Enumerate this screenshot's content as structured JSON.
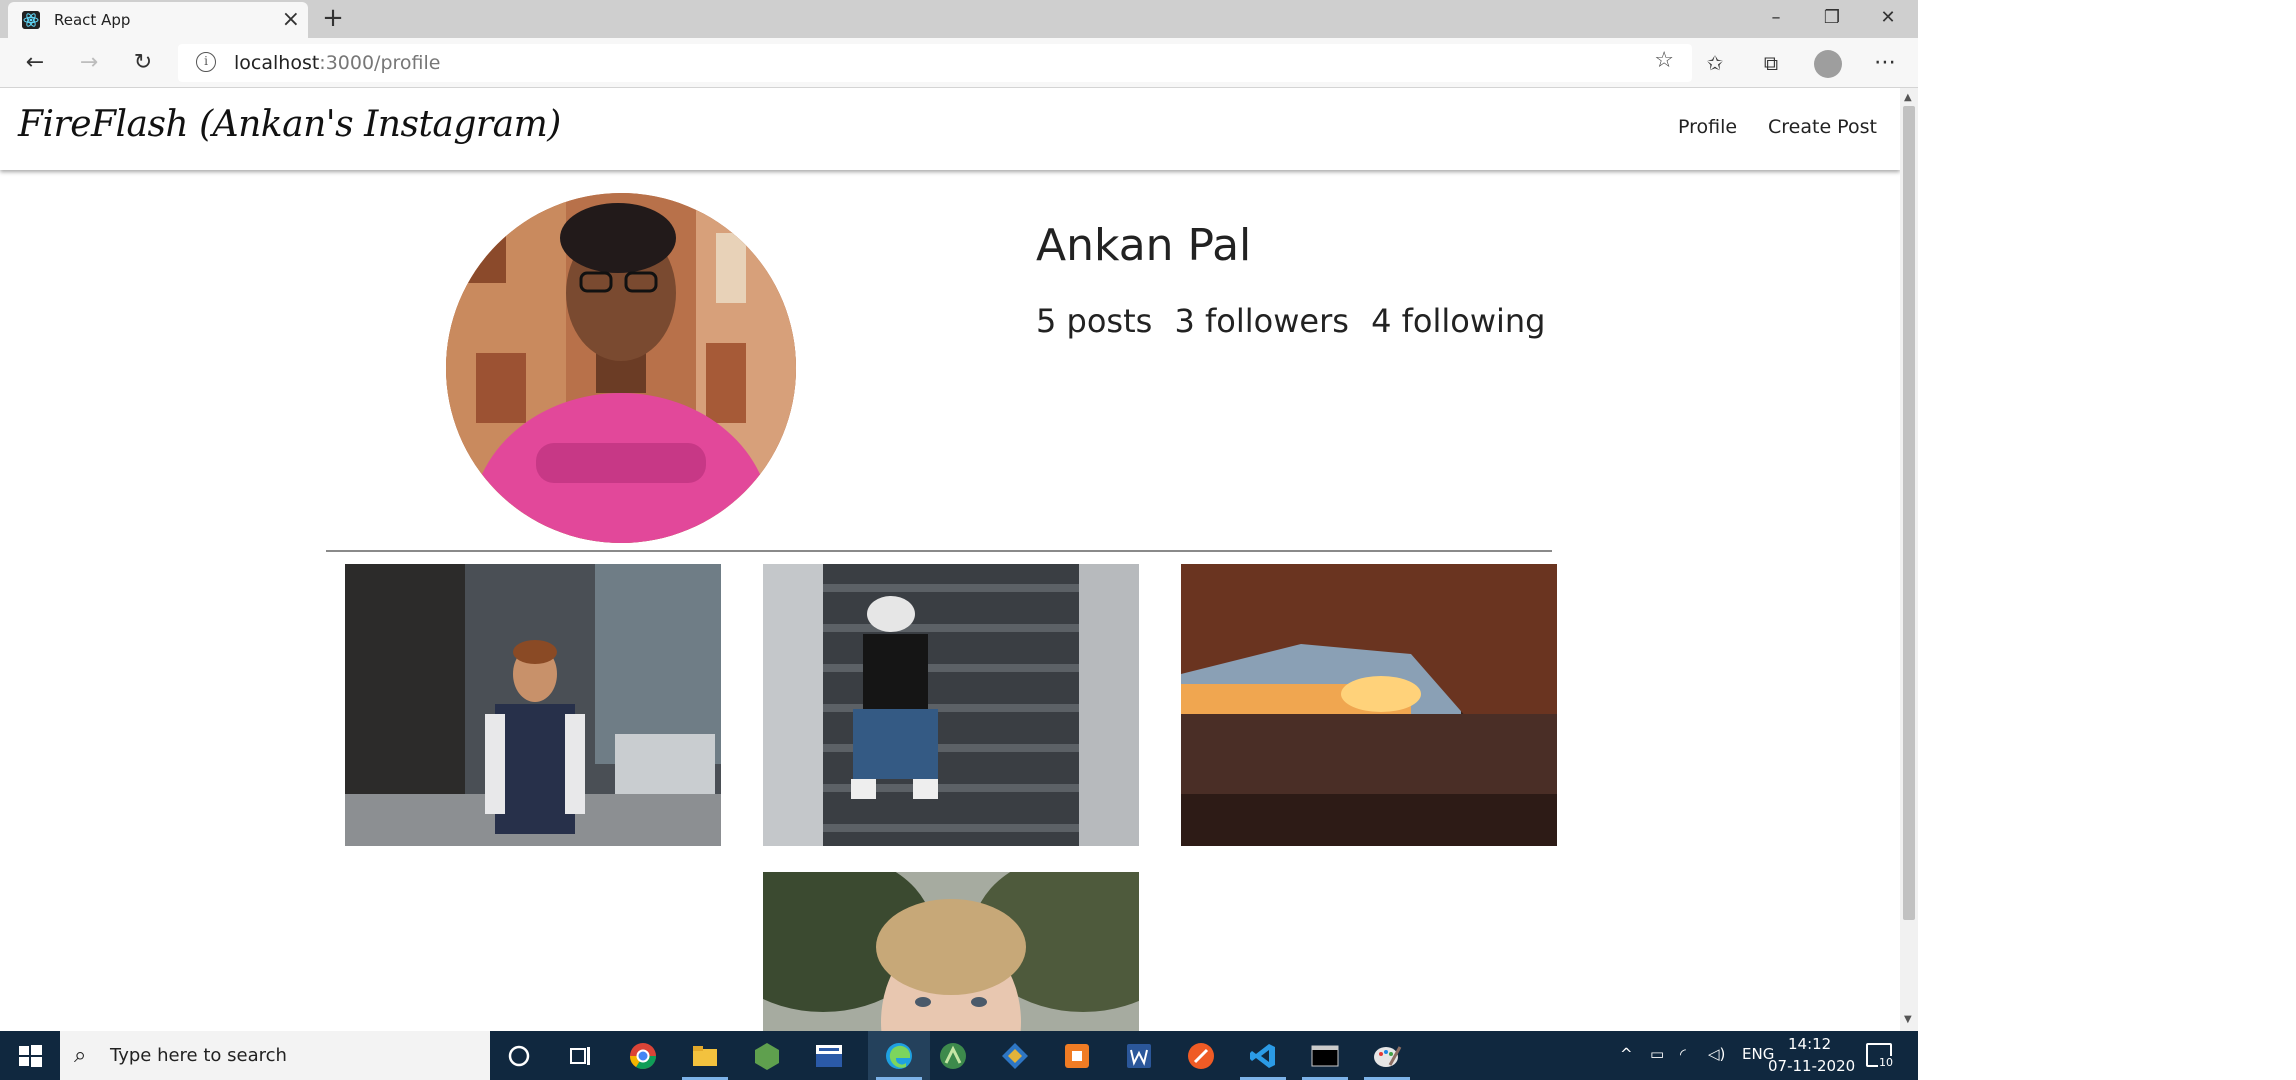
{
  "browser": {
    "tab_title": "React App",
    "address_host": "localhost",
    "address_path": ":3000/profile"
  },
  "navbar": {
    "brand": "FireFlash (Ankan's Instagram)",
    "links": [
      "Profile",
      "Create Post"
    ]
  },
  "profile": {
    "name": "Ankan Pal",
    "posts": "5 posts",
    "followers": "3 followers",
    "following": "4 following"
  },
  "taskbar": {
    "search_placeholder": "Type here to search",
    "language": "ENG",
    "time": "14:12",
    "date": "07-11-2020",
    "notification_count": "10"
  },
  "colors": {
    "taskbar": "#10283f",
    "tab_strip": "#cfcfcf"
  }
}
